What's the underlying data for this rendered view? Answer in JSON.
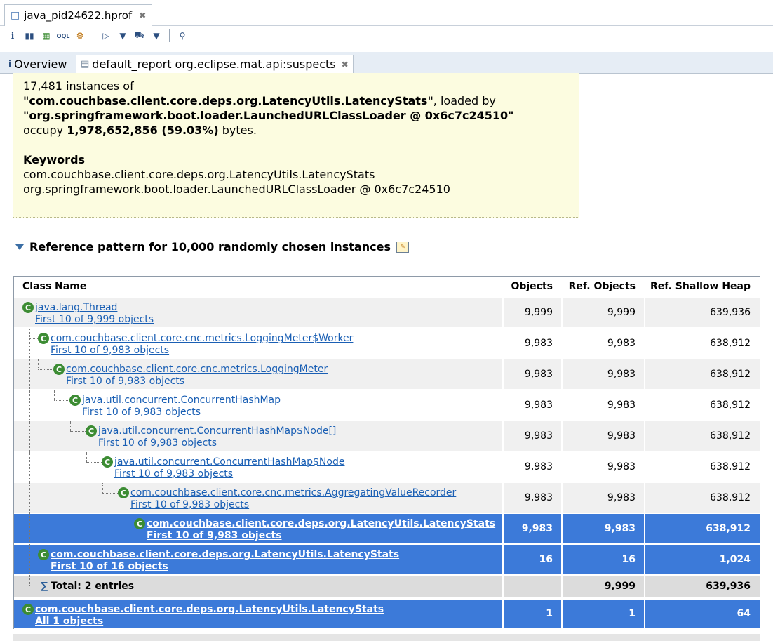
{
  "editor": {
    "tab_title": "java_pid24622.hprof"
  },
  "inner_tabs": {
    "overview": "Overview",
    "report": "default_report  org.eclipse.mat.api:suspects"
  },
  "summary": {
    "line1": "17,481 instances of",
    "class_name": "\"com.couchbase.client.core.deps.org.LatencyUtils.LatencyStats\"",
    "loaded_by": ", loaded by",
    "loader": "\"org.springframework.boot.loader.LaunchedURLClassLoader @ 0x6c7c24510\"",
    "occupy": "occupy",
    "bytes_value": "1,978,652,856 (59.03%)",
    "bytes_suffix": "bytes.",
    "keywords_title": "Keywords",
    "keyword1": "com.couchbase.client.core.deps.org.LatencyUtils.LatencyStats",
    "keyword2": "org.springframework.boot.loader.LaunchedURLClassLoader @ 0x6c7c24510"
  },
  "section": {
    "title": "Reference pattern for 10,000 randomly chosen instances"
  },
  "table": {
    "headers": {
      "name": "Class Name",
      "objects": "Objects",
      "ref_objects": "Ref. Objects",
      "ref_heap": "Ref. Shallow Heap"
    },
    "rows": [
      {
        "name": "java.lang.Thread",
        "sub": "First 10 of 9,999 objects",
        "objects": "9,999",
        "ref_objects": "9,999",
        "ref_heap": "639,936"
      },
      {
        "name": "com.couchbase.client.core.cnc.metrics.LoggingMeter$Worker",
        "sub": "First 10 of 9,983 objects",
        "objects": "9,983",
        "ref_objects": "9,983",
        "ref_heap": "638,912"
      },
      {
        "name": "com.couchbase.client.core.cnc.metrics.LoggingMeter",
        "sub": "First 10 of 9,983 objects",
        "objects": "9,983",
        "ref_objects": "9,983",
        "ref_heap": "638,912"
      },
      {
        "name": "java.util.concurrent.ConcurrentHashMap",
        "sub": "First 10 of 9,983 objects",
        "objects": "9,983",
        "ref_objects": "9,983",
        "ref_heap": "638,912"
      },
      {
        "name": "java.util.concurrent.ConcurrentHashMap$Node[]",
        "sub": "First 10 of 9,983 objects",
        "objects": "9,983",
        "ref_objects": "9,983",
        "ref_heap": "638,912"
      },
      {
        "name": "java.util.concurrent.ConcurrentHashMap$Node",
        "sub": "First 10 of 9,983 objects",
        "objects": "9,983",
        "ref_objects": "9,983",
        "ref_heap": "638,912"
      },
      {
        "name": "com.couchbase.client.core.cnc.metrics.AggregatingValueRecorder",
        "sub": "First 10 of 9,983 objects",
        "objects": "9,983",
        "ref_objects": "9,983",
        "ref_heap": "638,912"
      },
      {
        "name": "com.couchbase.client.core.deps.org.LatencyUtils.LatencyStats",
        "sub": "First 10 of 9,983 objects",
        "objects": "9,983",
        "ref_objects": "9,983",
        "ref_heap": "638,912"
      },
      {
        "name": "com.couchbase.client.core.deps.org.LatencyUtils.LatencyStats",
        "sub": "First 10 of 16 objects",
        "objects": "16",
        "ref_objects": "16",
        "ref_heap": "1,024"
      },
      {
        "name": "com.couchbase.client.core.deps.org.LatencyUtils.LatencyStats",
        "sub": "All 1 objects",
        "objects": "1",
        "ref_objects": "1",
        "ref_heap": "64"
      }
    ],
    "total": {
      "label": "Total: 2 entries",
      "objects": "",
      "ref_objects": "9,999",
      "ref_heap": "639,936"
    }
  }
}
